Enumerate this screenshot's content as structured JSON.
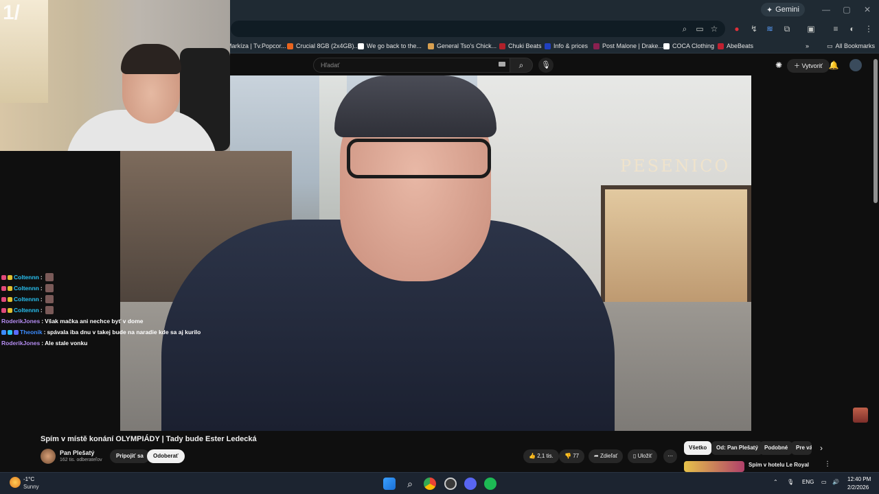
{
  "browser": {
    "gemini_label": "Gemini",
    "bookmarks": [
      {
        "label": "Markíza | Tv.Popcor...",
        "color": "#1f2a33"
      },
      {
        "label": "Crucial 8GB (2x4GB)...",
        "color": "#e8641e"
      },
      {
        "label": "We go back to the...",
        "color": "#ffffff"
      },
      {
        "label": "General Tso's Chick...",
        "color": "#d8a050"
      },
      {
        "label": "Chuki Beats",
        "color": "#b0202a"
      },
      {
        "label": "Info & prices",
        "color": "#2040c0"
      },
      {
        "label": "Post Malone | Drake...",
        "color": "#8a2050"
      },
      {
        "label": "COCA Clothing",
        "color": "#ffffff"
      },
      {
        "label": "AbeBeats",
        "color": "#c02030"
      }
    ],
    "all_bookmarks_label": "All Bookmarks"
  },
  "youtube": {
    "search_placeholder": "Hľadať",
    "create_label": "Vytvoriť",
    "video_title": "Spím v místě konání OLYMPIÁDY | Tady bude Ester Ledecká",
    "channel_name": "Pan Plešatý",
    "subscribers": "162 tis. odberateľov",
    "join_label": "Pripojiť sa",
    "subscribe_label": "Odoberať",
    "likes": "2,1 tis.",
    "dislikes": "77",
    "share_label": "Zdieľať",
    "save_label": "Uložiť",
    "chips": [
      "Všetko",
      "Od: Pan Plešatý",
      "Podobné",
      "Pre vá"
    ],
    "rec_title": "Spím v hotelu Le Royal",
    "shop_sign": "PESENICO"
  },
  "stream": {
    "counter": "1/",
    "chat": [
      {
        "user": "Coltennn",
        "message": "",
        "color": "#28c0f0",
        "emote": true
      },
      {
        "user": "Coltennn",
        "message": "",
        "color": "#28c0f0",
        "emote": true
      },
      {
        "user": "Coltennn",
        "message": "",
        "color": "#28c0f0",
        "emote": true
      },
      {
        "user": "Coltennn",
        "message": "",
        "color": "#28c0f0",
        "emote": true
      },
      {
        "user": "RoderikJones",
        "message": "Však mačka ani nechce byť v dome",
        "color": "#b48cf0",
        "emote": false
      },
      {
        "user": "Theonik",
        "message": "spávala iba dnu v takej bude na naradie kde sa aj kurilo",
        "color": "#3c8cff",
        "emote": false
      },
      {
        "user": "RoderikJones",
        "message": "Ale stale vonku",
        "color": "#b48cf0",
        "emote": false
      }
    ]
  },
  "taskbar": {
    "temperature": "-1°C",
    "condition": "Sunny",
    "language": "ENG",
    "time": "12:40 PM",
    "date": "2/2/2026"
  }
}
